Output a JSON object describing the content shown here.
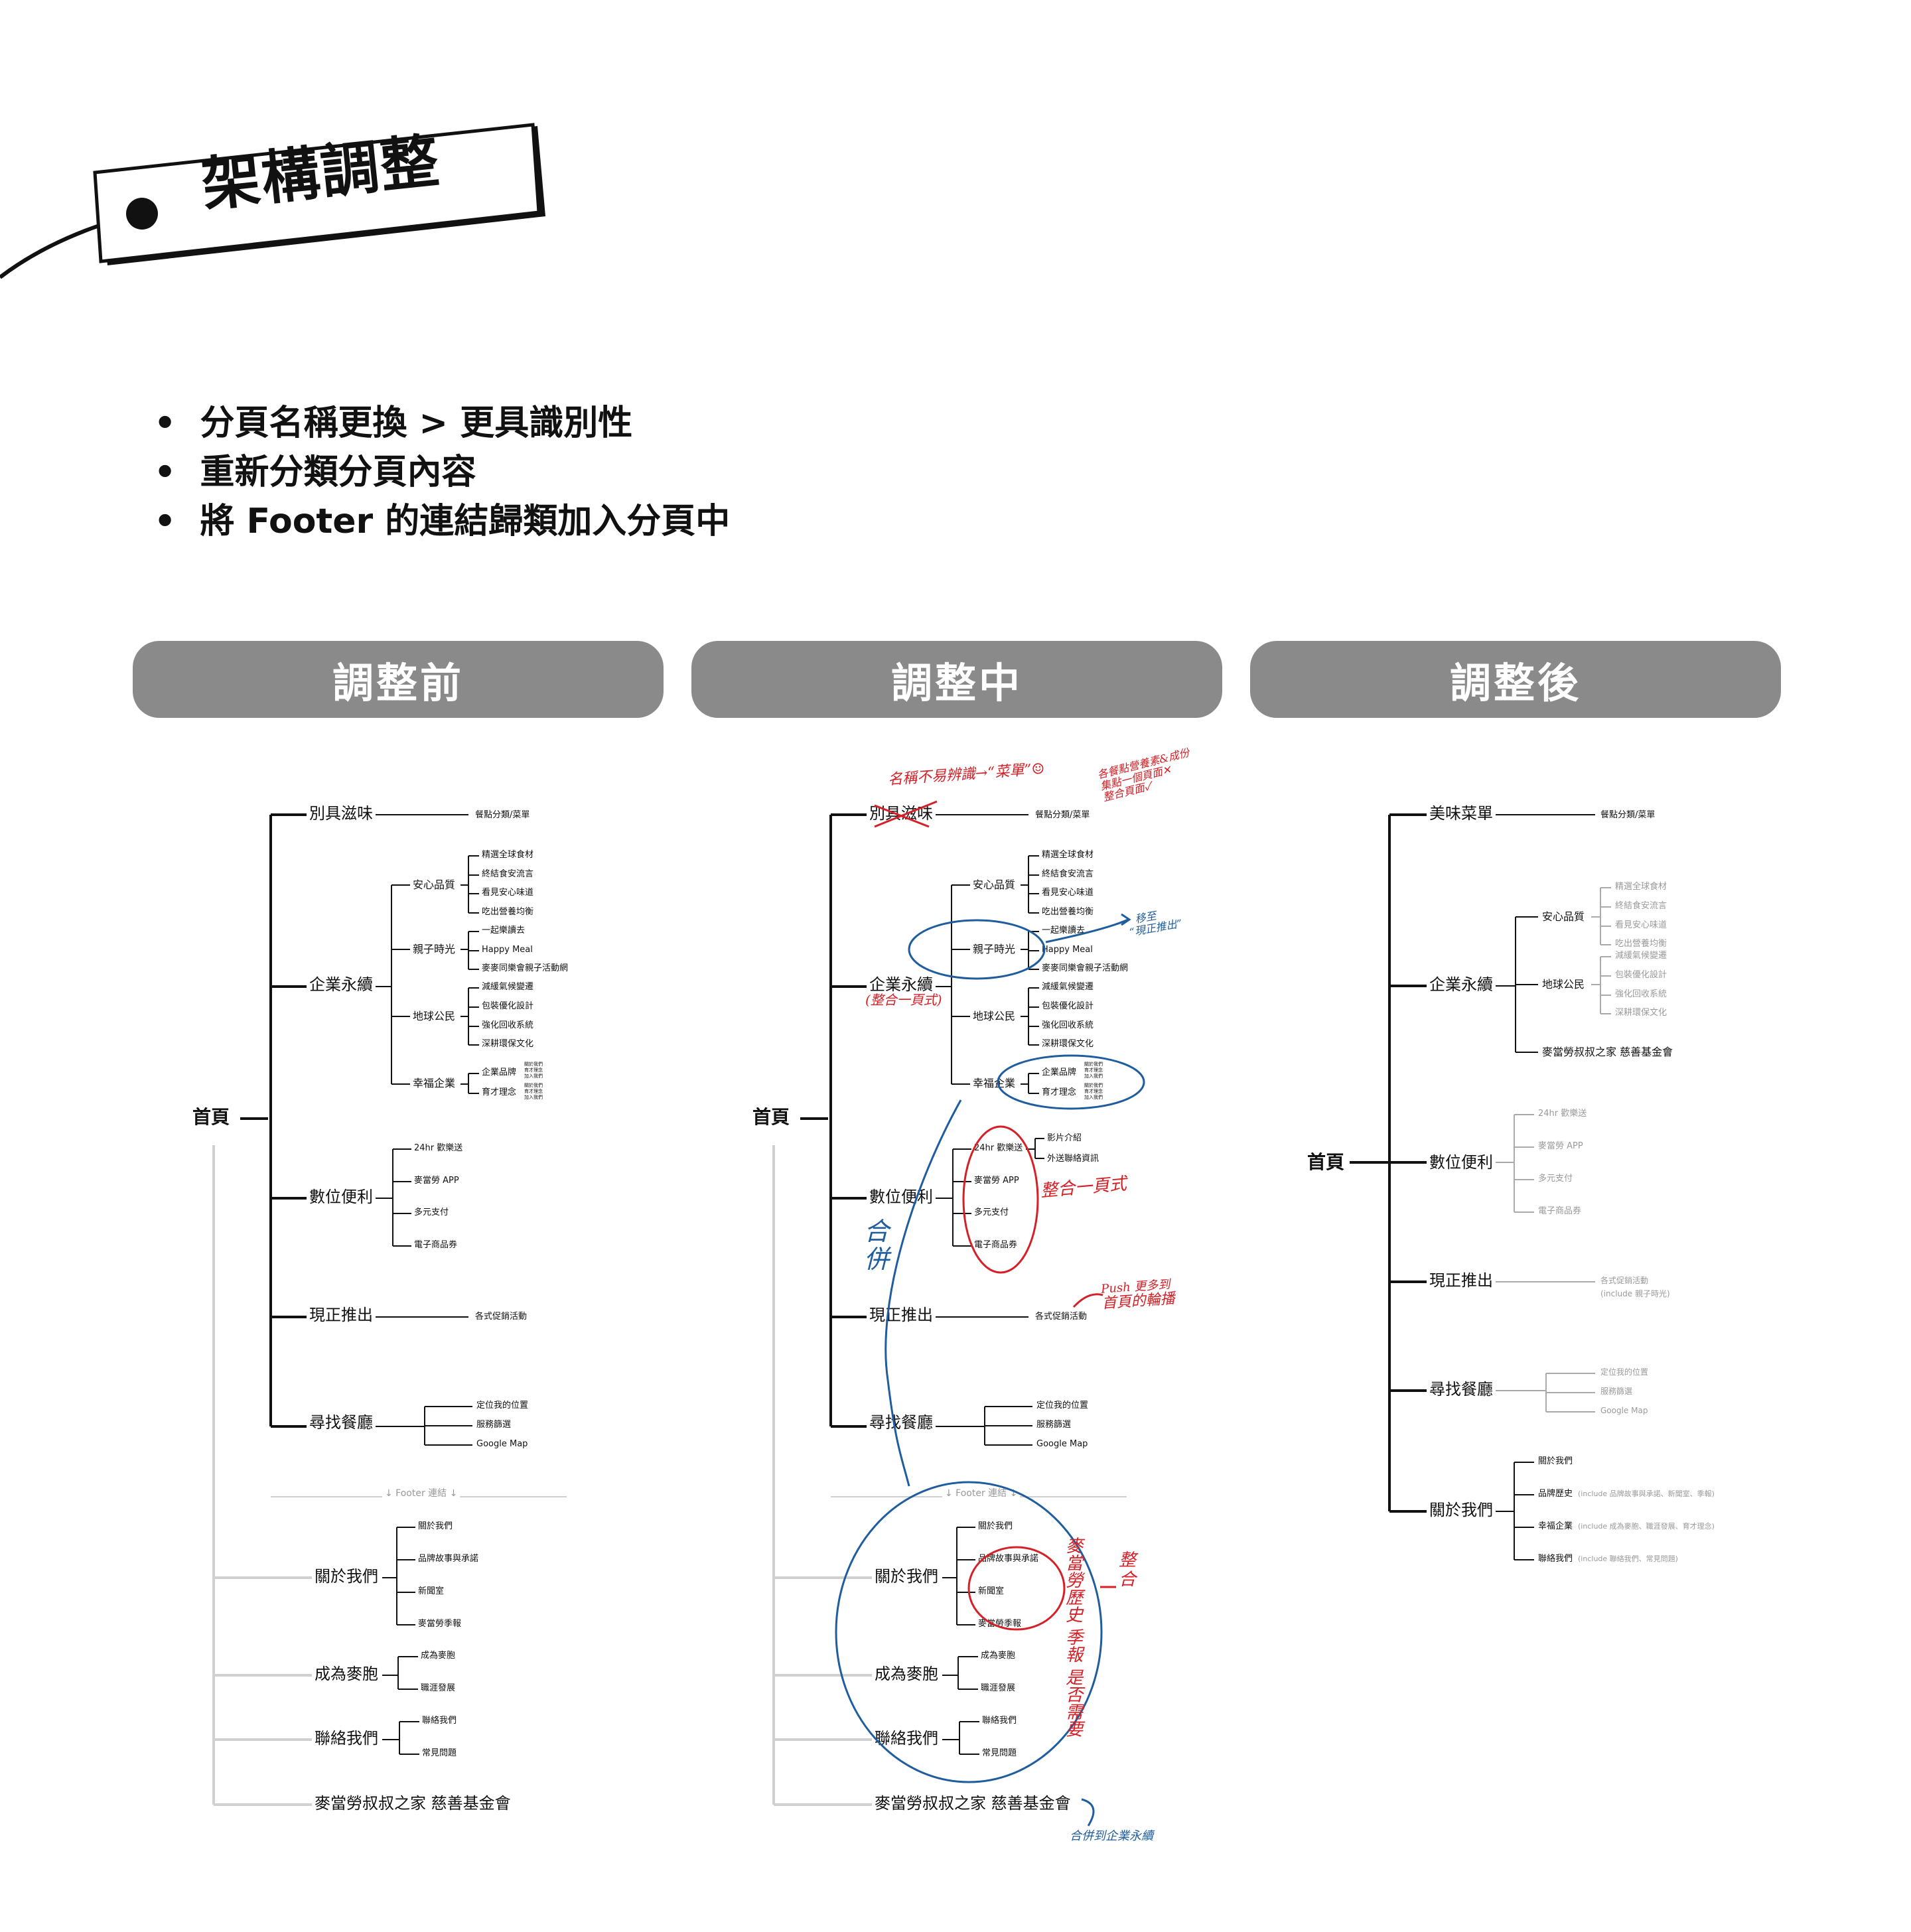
{
  "title": "架構調整",
  "bullets": [
    "分頁名稱更換 > 更具識別性",
    "重新分類分頁內容",
    "將 Footer 的連結歸類加入分頁中"
  ],
  "headers": [
    "調整前",
    "調整中",
    "調整後"
  ],
  "before": {
    "root": "首頁",
    "n1": "別具滋味",
    "n1_sub": "餐點分類/菜單",
    "n2": "企業永續",
    "n2a": "安心品質",
    "n2a_items": [
      "精選全球食材",
      "終結食安流言",
      "看見安心味道",
      "吃出營養均衡"
    ],
    "n2b": "親子時光",
    "n2b_items": [
      "一起樂讀去",
      "Happy Meal",
      "麥麥同樂會親子活動網"
    ],
    "n2c": "地球公民",
    "n2c_items": [
      "減緩氣候變遷",
      "包裝優化設計",
      "強化回收系統",
      "深耕環保文化"
    ],
    "n2d": "幸福企業",
    "n2d_items": [
      "企業品牌",
      "育才理念"
    ],
    "n2d_tiny": [
      "關於我們\n育才理念\n加入我們",
      "關於我們\n育才理念\n加入我們"
    ],
    "n3": "數位便利",
    "n3_items": [
      "24hr 歡樂送",
      "麥當勞 APP",
      "多元支付",
      "電子商品券"
    ],
    "n4": "現正推出",
    "n4_sub": "各式促銷活動",
    "n5": "尋找餐廳",
    "n5_items": [
      "定位我的位置",
      "服務篩選",
      "Google Map"
    ],
    "footer_label": "↓ Footer 連結 ↓",
    "f1": "關於我們",
    "f1_items": [
      "關於我們",
      "品牌故事與承諾",
      "新聞室",
      "麥當勞季報"
    ],
    "f2": "成為麥胞",
    "f2_items": [
      "成為麥胞",
      "職涯發展"
    ],
    "f3": "聯絡我們",
    "f3_items": [
      "聯絡我們",
      "常見問題"
    ],
    "f4": "麥當勞叔叔之家 慈善基金會"
  },
  "middle": {
    "n3_extra": [
      "影片介紹",
      "外送聯絡資訊"
    ],
    "notes": {
      "name_hard": "名稱不易辨識→“菜單”☺",
      "menu_note": [
        "各餐點營養素&成份",
        "集點一個頁面✕",
        "整合頁面✓"
      ],
      "move_to": [
        "移至",
        "“現正推出”"
      ],
      "merge_page": "(整合一頁式)",
      "merge_page2": "整合一頁式",
      "hebing": [
        "合",
        "併"
      ],
      "push": [
        "Push 更多到",
        "首頁的輪播"
      ],
      "brand_history": [
        "麥當勞歷史",
        "季報",
        "是否需要"
      ],
      "integrate": [
        "整",
        "合"
      ],
      "merge_csr": "合併到企業永續"
    }
  },
  "after": {
    "root": "首頁",
    "n1": "美味菜單",
    "n1_sub": "餐點分類/菜單",
    "n2": "企業永續",
    "n2a": "安心品質",
    "n2a_items": [
      "精選全球食材",
      "終結食安流言",
      "看見安心味道",
      "吃出營養均衡"
    ],
    "n2c": "地球公民",
    "n2c_items": [
      "減緩氣候變遷",
      "包裝優化設計",
      "強化回收系統",
      "深耕環保文化"
    ],
    "n2e": "麥當勞叔叔之家 慈善基金會",
    "n3": "數位便利",
    "n3_items": [
      "24hr 歡樂送",
      "麥當勞 APP",
      "多元支付",
      "電子商品券"
    ],
    "n4": "現正推出",
    "n4_sub": [
      "各式促銷活動",
      "(include 親子時光)"
    ],
    "n5": "尋找餐廳",
    "n5_items": [
      "定位我的位置",
      "服務篩選",
      "Google Map"
    ],
    "n6": "關於我們",
    "n6_items": [
      "關於我們",
      "品牌歷史",
      "幸福企業",
      "聯絡我們"
    ],
    "n6_notes": [
      "",
      "(include 品牌故事與承諾、新聞室、季報)",
      "(include 成為麥胞、職涯發展、育才理念)",
      "(include 聯絡我們、常見問題)"
    ]
  }
}
